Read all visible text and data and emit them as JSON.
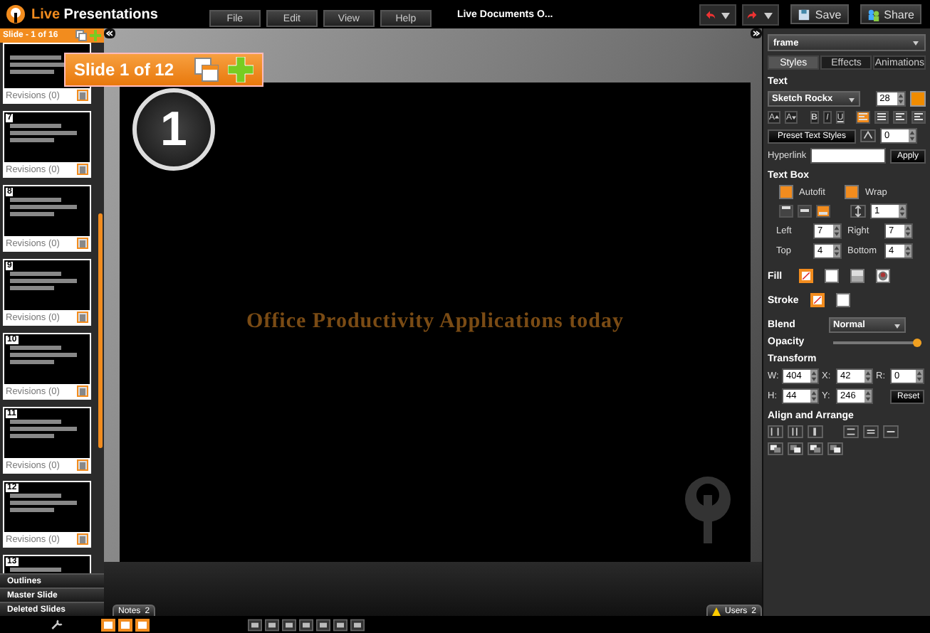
{
  "header": {
    "brand_prefix": "Live",
    "brand_name": "Presentations",
    "menus": [
      "File",
      "Edit",
      "View",
      "Help"
    ],
    "document_title": "Live Documents O...",
    "save": "Save",
    "share": "Share"
  },
  "sidebar": {
    "title": "Slide - 1 of 16",
    "thumbnails": [
      {
        "revisions": "Revisions (0)"
      },
      {
        "number": "7",
        "revisions": "Revisions (0)"
      },
      {
        "number": "8",
        "revisions": "Revisions (0)"
      },
      {
        "number": "9",
        "revisions": "Revisions (0)"
      },
      {
        "number": "10",
        "revisions": "Revisions (0)"
      },
      {
        "number": "11",
        "revisions": "Revisions (0)"
      },
      {
        "number": "12",
        "revisions": "Revisions (0)"
      },
      {
        "number": "13"
      }
    ],
    "sections": [
      "Outlines",
      "Master Slide",
      "Deleted Slides"
    ]
  },
  "slide": {
    "badge": "Slide 1 of 12",
    "number": "1",
    "title": "Office Productivity Applications today"
  },
  "panel": {
    "object": "frame",
    "tabs": [
      {
        "label": "Styles",
        "selected": true
      },
      {
        "label": "Effects",
        "selected": false
      },
      {
        "label": "Animations",
        "selected": false
      }
    ],
    "text": {
      "heading": "Text",
      "font": "Sketch Rockx",
      "size": "28",
      "color": "#f08c00",
      "size_buttons": [
        "A",
        "A"
      ],
      "styles": [
        "B",
        "I",
        "U"
      ],
      "align": [
        {
          "selected": true
        },
        {
          "selected": false
        },
        {
          "selected": false
        },
        {
          "selected": false
        }
      ],
      "preset": "Preset Text Styles",
      "spacing": "0",
      "hyperlink_label": "Hyperlink",
      "apply": "Apply"
    },
    "text_box": {
      "heading": "Text Box",
      "options": [
        {
          "label": "Autofit",
          "checked": true
        },
        {
          "label": "Wrap",
          "checked": true
        }
      ],
      "valign": [
        {
          "selected": false
        },
        {
          "selected": false
        },
        {
          "selected": true
        }
      ],
      "line_spacing": "1",
      "margins": [
        {
          "label": "Left",
          "value": "7"
        },
        {
          "label": "Right",
          "value": "7"
        },
        {
          "label": "Top",
          "value": "4"
        },
        {
          "label": "Bottom",
          "value": "4"
        }
      ]
    },
    "fill": {
      "label": "Fill",
      "options": [
        {
          "kind": "none",
          "selected": true
        },
        {
          "kind": "solid",
          "selected": false
        },
        {
          "kind": "gradient",
          "selected": false
        },
        {
          "kind": "image",
          "selected": false
        }
      ]
    },
    "stroke": {
      "label": "Stroke",
      "options": [
        {
          "kind": "none",
          "selected": true
        },
        {
          "kind": "solid",
          "selected": false
        }
      ]
    },
    "blend": {
      "label": "Blend",
      "value": "Normal"
    },
    "opacity": {
      "label": "Opacity",
      "level": 0.95
    },
    "transform": {
      "heading": "Transform",
      "fields": [
        {
          "label": "W:",
          "value": "404"
        },
        {
          "label": "X:",
          "value": "42"
        },
        {
          "label": "R:",
          "value": "0"
        },
        {
          "label": "H:",
          "value": "44"
        },
        {
          "label": "Y:",
          "value": "246"
        }
      ],
      "reset": "Reset"
    },
    "arrange": {
      "heading": "Align and Arrange"
    }
  },
  "footer": {
    "notes": "Notes",
    "notes_count": "2",
    "users": "Users",
    "users_count": "2"
  }
}
